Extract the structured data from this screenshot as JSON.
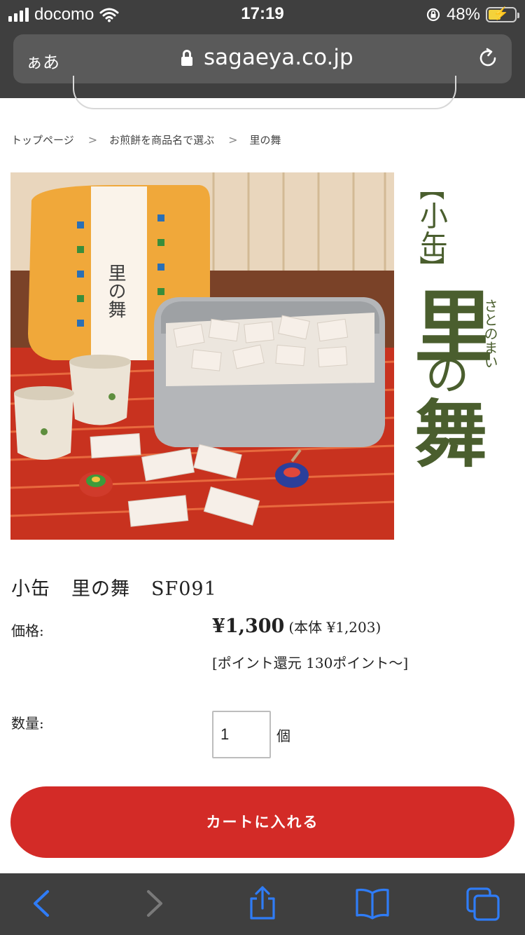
{
  "status_bar": {
    "carrier": "docomo",
    "time": "17:19",
    "battery_percent": "48%",
    "battery_level": 0.48,
    "icons": [
      "signal-bars-icon",
      "wifi-icon",
      "rotation-lock-icon",
      "battery-charging-icon"
    ]
  },
  "browser": {
    "text_size_label": "ぁあ",
    "url": "sagaeya.co.jp",
    "icons": [
      "lock-icon",
      "reload-icon",
      "back-icon",
      "forward-icon",
      "share-icon",
      "bookmarks-icon",
      "tabs-icon"
    ]
  },
  "breadcrumb": {
    "items": [
      "トップページ",
      "お煎餅を商品名で選ぶ",
      "里の舞"
    ]
  },
  "product": {
    "name_part1": "小缶",
    "name_part2": "里の舞",
    "code": "SF091",
    "price_label": "価格:",
    "price": "¥1,300",
    "price_excl_tax": "(本体 ¥1,203)",
    "points": "[ポイント還元 130ポイント〜]",
    "quantity_label": "数量:",
    "quantity_value": "1",
    "quantity_unit": "個",
    "add_to_cart_label": "カートに入れる",
    "logo": {
      "bracket_open": "【",
      "size": "小缶",
      "bracket_close": "】",
      "name": "里の舞",
      "reading": "さとのまい"
    }
  },
  "colors": {
    "system_bar": "#3f3f3f",
    "cart_button": "#d32b27",
    "logo_green": "#4a5e2e",
    "ios_blue": "#2f7cf6"
  }
}
